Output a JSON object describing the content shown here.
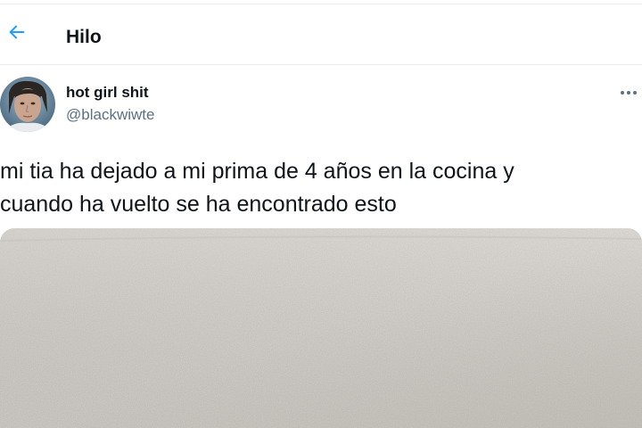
{
  "header": {
    "title": "Hilo",
    "back_icon": "arrow-left-icon"
  },
  "tweet": {
    "display_name": "hot girl shit",
    "handle": "@blackwiwte",
    "more_icon": "more-horizontal-icon",
    "text": "mi tia ha dejado a mi prima de 4 años en la cocina y\ncuando ha vuelto se ha encontrado esto"
  },
  "colors": {
    "accent": "#1da1f2",
    "secondary_text": "#5b7083",
    "divider": "#e6ecf0",
    "media_base": "#d9d6d0"
  }
}
